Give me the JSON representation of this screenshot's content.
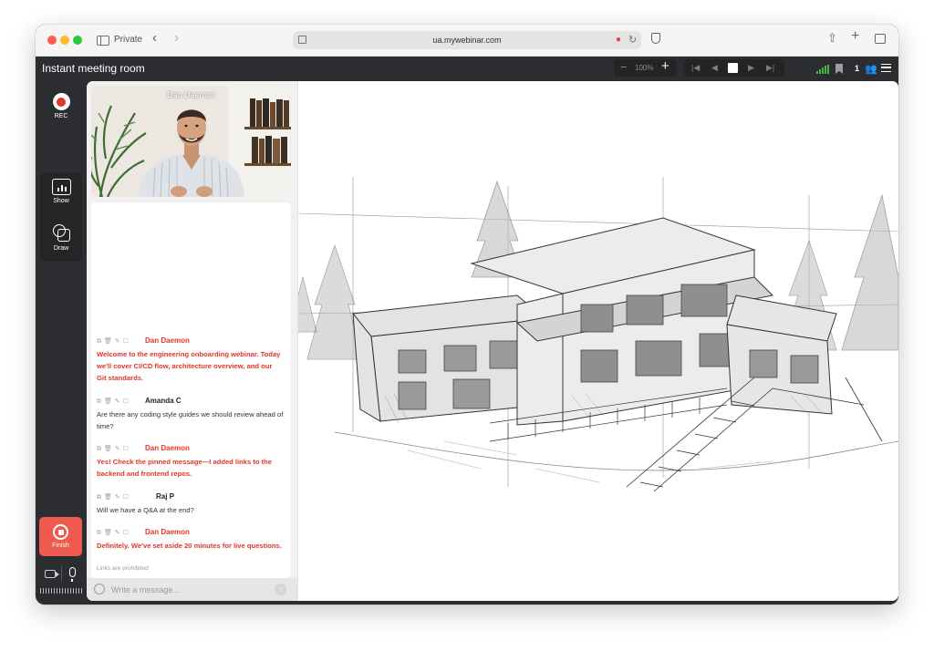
{
  "browser": {
    "private_label": "Private",
    "url": "ua.mywebinar.com"
  },
  "app": {
    "room_title": "Instant meeting room",
    "zoom_level": "100%",
    "participants_count": "1"
  },
  "rail": {
    "rec_label": "REC",
    "show_label": "Show",
    "draw_label": "Draw",
    "finish_label": "Finish"
  },
  "video": {
    "speaker_name": "Dan Daemon"
  },
  "chat": {
    "messages": [
      {
        "author": "Dan Daemon",
        "text": "Welcome to the engineering onboarding webinar. Today we'll cover CI/CD flow, architecture overview, and our Git standards.",
        "is_host": true
      },
      {
        "author": "Amanda C",
        "text": "Are there any coding style guides we should review ahead of time?",
        "is_host": false
      },
      {
        "author": "Dan Daemon",
        "text": "Yes! Check the pinned message—I added links to the backend and frontend repos.",
        "is_host": true
      },
      {
        "author": "Raj P",
        "text": "Will we have a Q&A at the end?",
        "is_host": false
      },
      {
        "author": "Dan Daemon",
        "text": "Definitely. We've set aside 20 minutes for live questions.",
        "is_host": true
      }
    ],
    "links_note": "Links are prohibited",
    "input_placeholder": "Write a message..."
  },
  "colors": {
    "accent_red": "#e5332a",
    "finish_button": "#ee5a4f",
    "toolbar_dark": "#2b2d30"
  }
}
